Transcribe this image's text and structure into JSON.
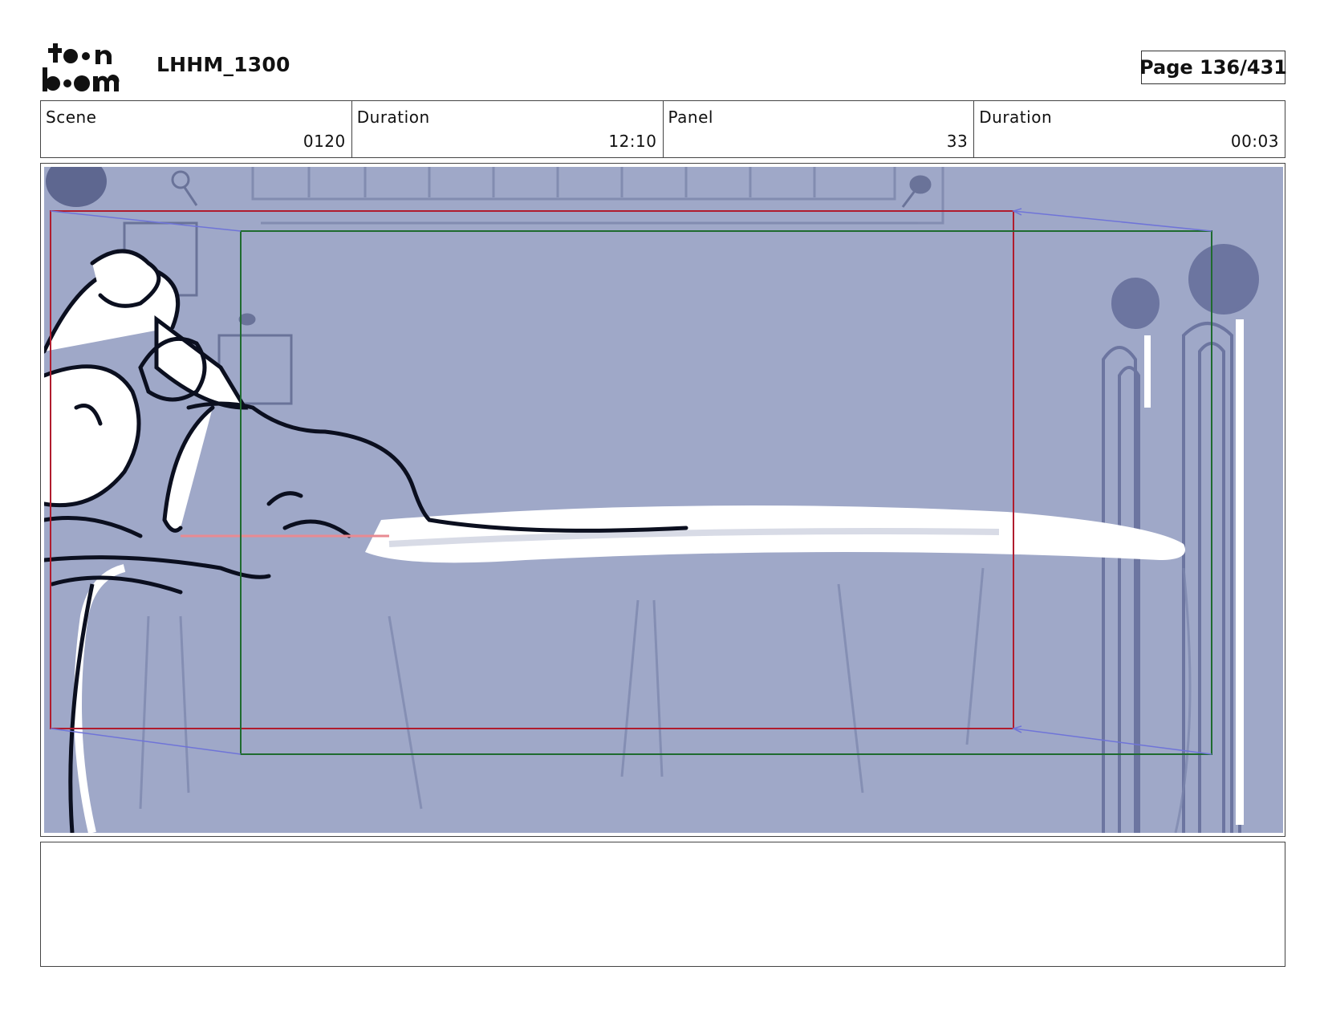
{
  "header": {
    "logo_text": "toon boom",
    "title": "LHHM_1300",
    "page_label": "Page 136/431"
  },
  "info": {
    "scene_label": "Scene",
    "scene_value": "0120",
    "scene_duration_label": "Duration",
    "scene_duration_value": "12:10",
    "panel_label": "Panel",
    "panel_value": "33",
    "panel_duration_label": "Duration",
    "panel_duration_value": "00:03"
  },
  "notes": {
    "text": ""
  },
  "colors": {
    "panel_background": "#9fa8c8",
    "camera_start_frame": "#b01c2e",
    "camera_end_frame": "#1f6b2f",
    "camera_move_lines": "#6f74d8"
  }
}
